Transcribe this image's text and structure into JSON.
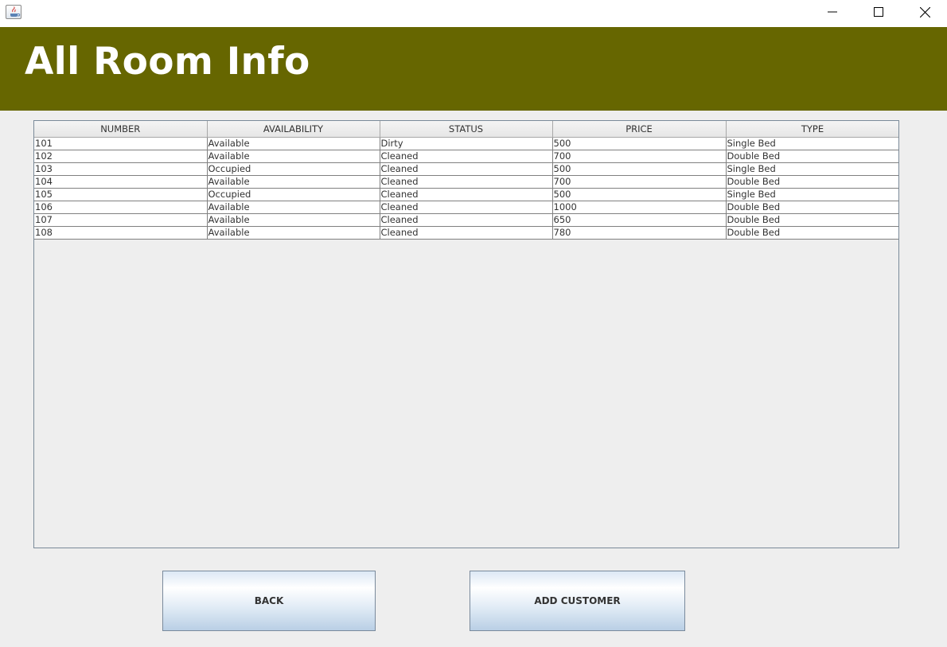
{
  "window": {
    "icon": "java-icon",
    "controls": [
      "minimize-icon",
      "maximize-icon",
      "close-icon"
    ]
  },
  "header": {
    "title": "All Room Info",
    "background": "#666600"
  },
  "table": {
    "columns": [
      "NUMBER",
      "AVAILABILITY",
      "STATUS",
      "PRICE",
      "TYPE"
    ],
    "rows": [
      [
        "101",
        "Available",
        "Dirty",
        "500",
        "Single Bed"
      ],
      [
        "102",
        "Available",
        "Cleaned",
        "700",
        "Double Bed"
      ],
      [
        "103",
        "Occupied",
        "Cleaned",
        "500",
        "Single Bed"
      ],
      [
        "104",
        "Available",
        "Cleaned",
        "700",
        "Double Bed"
      ],
      [
        "105",
        "Occupied",
        "Cleaned",
        "500",
        "Single Bed"
      ],
      [
        "106",
        "Available",
        "Cleaned",
        "1000",
        "Double Bed"
      ],
      [
        "107",
        "Available",
        "Cleaned",
        "650",
        "Double Bed"
      ],
      [
        "108",
        "Available",
        "Cleaned",
        "780",
        "Double Bed"
      ]
    ]
  },
  "buttons": {
    "back_label": "BACK",
    "add_customer_label": "ADD CUSTOMER"
  }
}
